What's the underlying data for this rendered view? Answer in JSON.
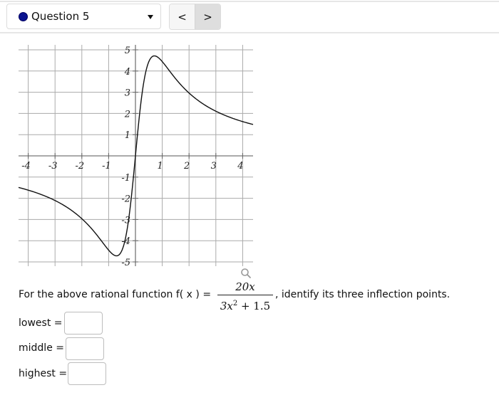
{
  "header": {
    "question_selector": {
      "label": "Question 5",
      "status_color": "#0b138f",
      "caret_icon": "caret-down-icon"
    },
    "nav": {
      "prev_label": "<",
      "next_label": ">"
    }
  },
  "chart_data": {
    "type": "line",
    "title": "",
    "xlabel": "",
    "ylabel": "",
    "function": "f(x) = 20x / (3x^2 + 1.5)",
    "xlim": [
      -4.4,
      4.4
    ],
    "ylim": [
      -5.3,
      5.3
    ],
    "grid": true,
    "x_ticks": [
      -4,
      -3,
      -2,
      -1,
      1,
      2,
      3,
      4
    ],
    "y_ticks": [
      -5,
      -4,
      -3,
      -2,
      -1,
      1,
      2,
      3,
      4,
      5
    ],
    "x_tick_labels": [
      "-4",
      "-3",
      "-2",
      "-1",
      "1",
      "2",
      "3",
      "4"
    ],
    "y_tick_labels": [
      "-5",
      "-4",
      "-3",
      "-2",
      "-1",
      "1",
      "2",
      "3",
      "4",
      "5"
    ],
    "series": [
      {
        "name": "f(x)",
        "x": [
          -4.4,
          -4,
          -3.5,
          -3,
          -2.5,
          -2,
          -1.5,
          -1.25,
          -1,
          -0.85,
          -0.707,
          -0.6,
          -0.5,
          -0.4,
          -0.3,
          -0.2,
          -0.1,
          0,
          0.1,
          0.2,
          0.3,
          0.4,
          0.5,
          0.6,
          0.707,
          0.85,
          1,
          1.25,
          1.5,
          2,
          2.5,
          3,
          3.5,
          4,
          4.4
        ],
        "y": [
          -1.485,
          -1.633,
          -1.856,
          -2.133,
          -2.5,
          -2.963,
          -3.333,
          -4.202,
          -4.444,
          -4.627,
          -4.714,
          -4.681,
          -4.444,
          -4.04,
          -3.448,
          -2.703,
          -1.29,
          0,
          1.29,
          2.703,
          3.448,
          4.04,
          4.444,
          4.681,
          4.714,
          4.627,
          4.444,
          4.202,
          3.333,
          2.963,
          2.5,
          2.133,
          1.856,
          1.633,
          1.485
        ]
      }
    ]
  },
  "zoom_icon": "magnifier-icon",
  "question": {
    "prompt_prefix": "For the above rational function f( x ) =",
    "numerator": "20x",
    "denominator_base": "3x",
    "denominator_exp": "2",
    "denominator_rest": " + 1.5",
    "prompt_suffix": ", identify its three inflection points."
  },
  "answers": [
    {
      "label": "lowest =",
      "value": "",
      "placeholder": ""
    },
    {
      "label": "middle =",
      "value": "",
      "placeholder": ""
    },
    {
      "label": "highest =",
      "value": "",
      "placeholder": ""
    }
  ]
}
